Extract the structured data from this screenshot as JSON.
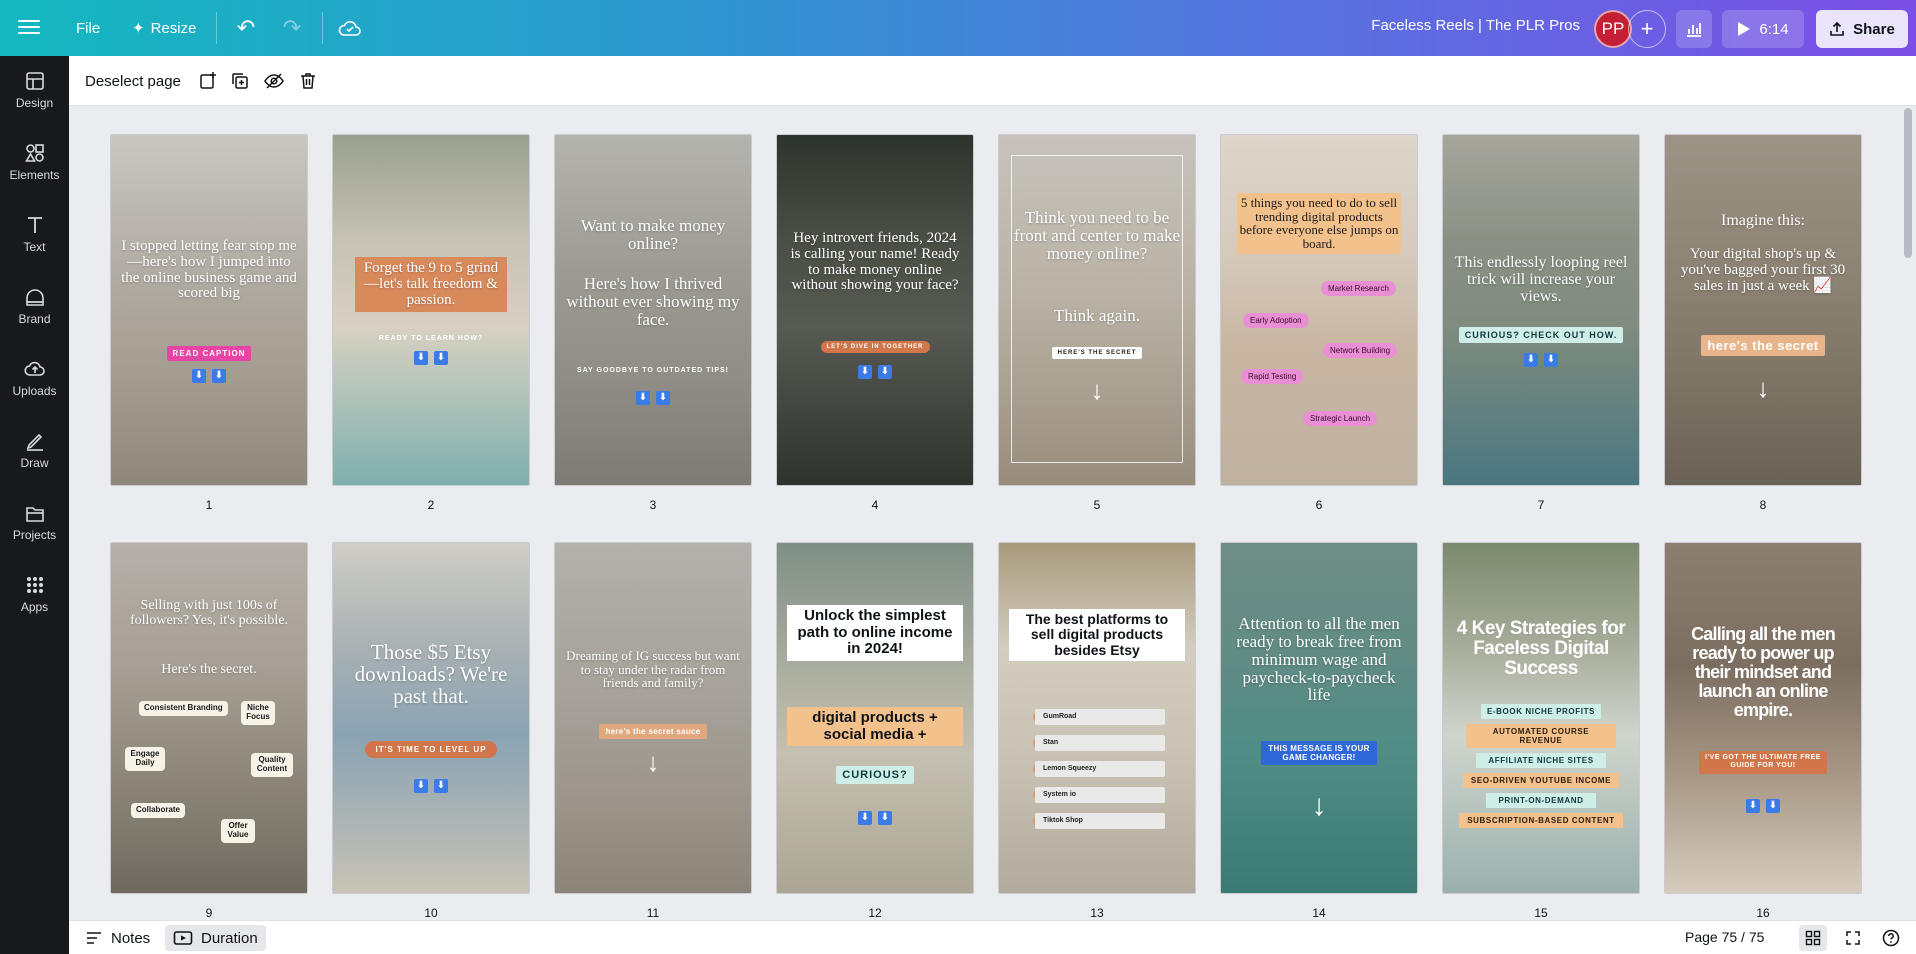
{
  "topbar": {
    "file_label": "File",
    "resize_label": "Resize",
    "doc_title": "Faceless Reels | The PLR Pros",
    "avatar_initials": "PP",
    "play_time": "6:14",
    "share_label": "Share"
  },
  "sidebar": {
    "items": [
      {
        "label": "Design",
        "icon": "design-icon"
      },
      {
        "label": "Elements",
        "icon": "elements-icon"
      },
      {
        "label": "Text",
        "icon": "text-icon"
      },
      {
        "label": "Brand",
        "icon": "brand-icon"
      },
      {
        "label": "Uploads",
        "icon": "uploads-icon"
      },
      {
        "label": "Draw",
        "icon": "draw-icon"
      },
      {
        "label": "Projects",
        "icon": "projects-icon"
      },
      {
        "label": "Apps",
        "icon": "apps-icon"
      }
    ]
  },
  "page_toolbar": {
    "deselect_label": "Deselect page"
  },
  "pages": [
    {
      "number": "1",
      "text": "I stopped letting fear stop me—here's how I jumped into the online business game and scored big",
      "cta": "READ CAPTION"
    },
    {
      "number": "2",
      "text": "Forget the 9 to 5 grind—let's talk freedom & passion.",
      "cta": "READY TO LEARN HOW?"
    },
    {
      "number": "3",
      "text": "Want to make money online?",
      "text2": "Here's how I thrived without ever showing my face.",
      "cta": "SAY GOODBYE TO OUTDATED TIPS!"
    },
    {
      "number": "4",
      "text": "Hey introvert friends, 2024 is calling your name! Ready to make money online without showing your face?",
      "cta": "LET'S DIVE IN TOGETHER"
    },
    {
      "number": "5",
      "text": "Think you need to be front and center to make money online?",
      "text2": "Think again.",
      "cta": "HERE'S THE SECRET"
    },
    {
      "number": "6",
      "text": "5 things you need to do to sell trending digital products before everyone else jumps on board.",
      "tags": [
        "Market Research",
        "Early Adoption",
        "Network Building",
        "Rapid Testing",
        "Strategic Launch"
      ]
    },
    {
      "number": "7",
      "text": "This endlessly looping reel trick will increase your views.",
      "cta": "CURIOUS? CHECK OUT HOW."
    },
    {
      "number": "8",
      "text": "Imagine this:",
      "text2": "Your digital shop's up & you've bagged your first 30 sales in just a week 📈",
      "cta": "here's the secret"
    },
    {
      "number": "9",
      "text": "Selling with just 100s of followers? Yes, it's possible.",
      "text2": "Here's the secret.",
      "notes": [
        "Consistent Branding",
        "Niche Focus",
        "Engage Daily",
        "Quality Content",
        "Collaborate",
        "Offer Value"
      ]
    },
    {
      "number": "10",
      "text": "Those $5 Etsy downloads? We're past that.",
      "cta": "IT'S TIME TO LEVEL UP"
    },
    {
      "number": "11",
      "text": "Dreaming of IG success but want to stay under the radar from friends and family?",
      "cta": "here's the secret sauce"
    },
    {
      "number": "12",
      "text": "Unlock the simplest path to online income in 2024!",
      "text2": "digital products + social media +",
      "cta": "CURIOUS?"
    },
    {
      "number": "13",
      "text": "The best platforms to sell digital products besides Etsy",
      "list": [
        "GumRoad",
        "Stan",
        "Lemon Squeezy",
        "System io",
        "Tiktok Shop"
      ]
    },
    {
      "number": "14",
      "text": "Attention to all the men ready to break free from minimum wage and paycheck-to-paycheck life",
      "cta": "THIS MESSAGE IS YOUR GAME CHANGER!"
    },
    {
      "number": "15",
      "text": "4 Key Strategies for Faceless Digital Success",
      "list": [
        "E-BOOK NICHE PROFITS",
        "AUTOMATED COURSE REVENUE",
        "AFFILIATE NICHE SITES",
        "SEO-DRIVEN YOUTUBE INCOME",
        "PRINT-ON-DEMAND",
        "SUBSCRIPTION-BASED CONTENT"
      ]
    },
    {
      "number": "16",
      "text": "Calling all the men ready to power up their mindset and launch an online empire.",
      "cta": "I'VE GOT THE ULTIMATE FREE GUIDE FOR YOU!"
    }
  ],
  "bottombar": {
    "notes_label": "Notes",
    "duration_label": "Duration",
    "page_count": "Page 75 / 75"
  }
}
